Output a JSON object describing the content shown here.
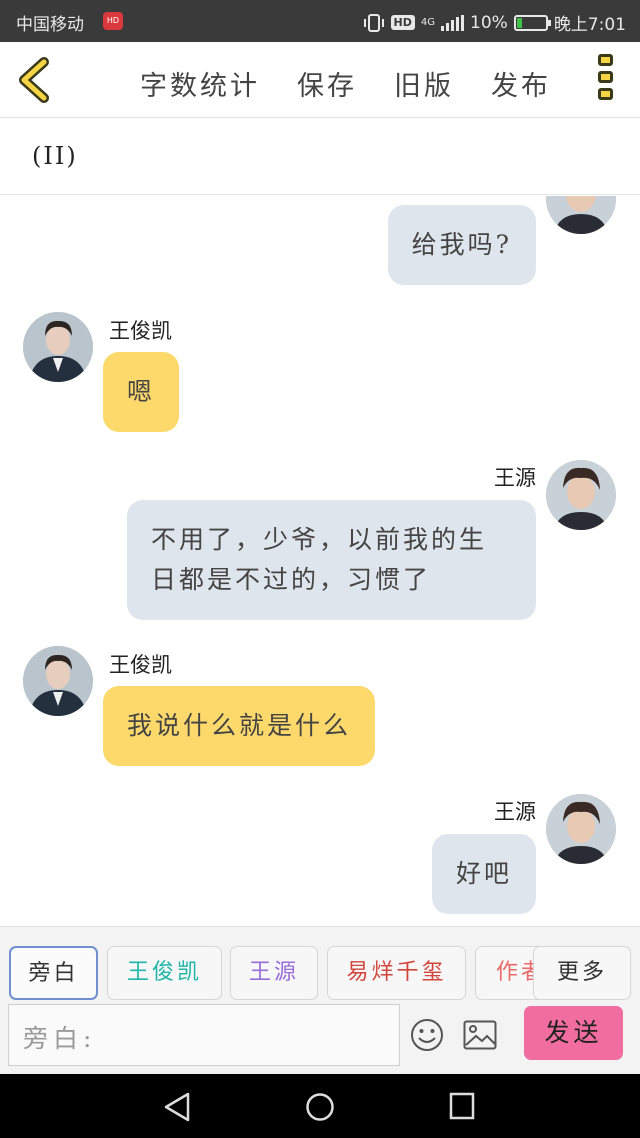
{
  "status_bar": {
    "carrier": "中国移动",
    "carrier_badge": "HD",
    "hd": "HD",
    "network": "4G",
    "battery_percent": "10%",
    "time": "晚上7:01"
  },
  "toolbar": {
    "word_count": "字数统计",
    "save": "保存",
    "old_version": "旧版",
    "publish": "发布"
  },
  "chapter_title": "(II)",
  "messages": [
    {
      "side": "right",
      "speaker": "",
      "text": "给我吗?"
    },
    {
      "side": "left",
      "speaker": "王俊凯",
      "text": "嗯"
    },
    {
      "side": "right",
      "speaker": "王源",
      "text": "不用了，少爷，以前我的生日都是不过的，习惯了"
    },
    {
      "side": "left",
      "speaker": "王俊凯",
      "text": "我说什么就是什么"
    },
    {
      "side": "right",
      "speaker": "王源",
      "text": "好吧"
    }
  ],
  "roles": [
    {
      "label": "旁白",
      "color": "#555555",
      "active": true
    },
    {
      "label": "王俊凯",
      "color": "#1fb5a8",
      "active": false
    },
    {
      "label": "王源",
      "color": "#9a6ed8",
      "active": false
    },
    {
      "label": "易烊千玺",
      "color": "#d2453c",
      "active": false
    },
    {
      "label": "作者",
      "color": "#e86a6a",
      "active": false
    }
  ],
  "more_roles": "更多",
  "input": {
    "placeholder": "旁白:"
  },
  "send_label": "发送",
  "colors": {
    "left_bubble": "#fdd96b",
    "right_bubble": "#dfe5ec",
    "send_button": "#f16d9f",
    "accent_yellow": "#f6d443"
  }
}
